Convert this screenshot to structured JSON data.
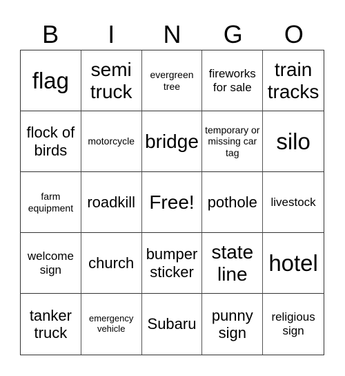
{
  "header": {
    "letters": [
      "B",
      "I",
      "N",
      "G",
      "O"
    ]
  },
  "board": {
    "cells": [
      "flag",
      "semi truck",
      "evergreen tree",
      "fireworks for sale",
      "train tracks",
      "flock of birds",
      "motorcycle",
      "bridge",
      "temporary or missing car tag",
      "silo",
      "farm equipment",
      "roadkill",
      "Free!",
      "pothole",
      "livestock",
      "welcome sign",
      "church",
      "bumper sticker",
      "state line",
      "hotel",
      "tanker truck",
      "emergency vehicle",
      "Subaru",
      "punny sign",
      "religious sign"
    ],
    "free_space": "Free!"
  }
}
